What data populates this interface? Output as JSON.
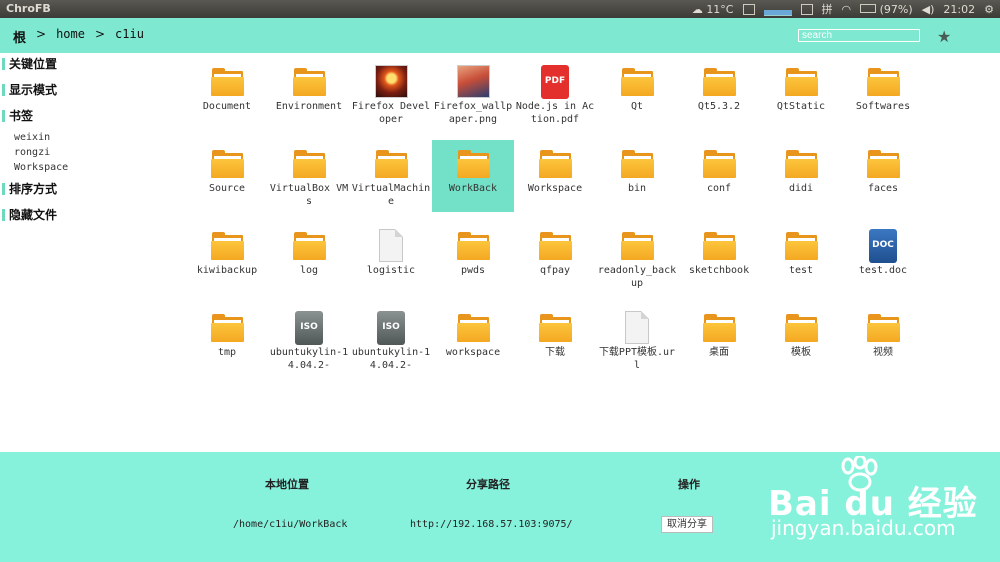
{
  "system_bar": {
    "app_title": "ChroFB",
    "temperature": "11°C",
    "battery": "(97%)",
    "clock": "21:02"
  },
  "header": {
    "breadcrumb": [
      "根",
      ">",
      "home",
      ">",
      "c1iu"
    ],
    "search_placeholder": "search"
  },
  "sidebar": {
    "key_locations": "关键位置",
    "display_mode": "显示模式",
    "bookmarks": "书签",
    "bookmark_items": [
      "weixin",
      "rongzi",
      "Workspace"
    ],
    "sort_mode": "排序方式",
    "hidden_files": "隐藏文件"
  },
  "files": [
    {
      "name": "Document",
      "type": "folder"
    },
    {
      "name": "Environment",
      "type": "folder"
    },
    {
      "name": "Firefox Developer",
      "type": "image"
    },
    {
      "name": "Firefox_wallpaper.png",
      "type": "image2"
    },
    {
      "name": "Node.js in Action.pdf",
      "type": "pdf"
    },
    {
      "name": "Qt",
      "type": "folder"
    },
    {
      "name": "Qt5.3.2",
      "type": "folder"
    },
    {
      "name": "QtStatic",
      "type": "folder"
    },
    {
      "name": "Softwares",
      "type": "folder"
    },
    {
      "name": "Source",
      "type": "folder"
    },
    {
      "name": "VirtualBox VMs",
      "type": "folder"
    },
    {
      "name": "VirtualMachine",
      "type": "folder"
    },
    {
      "name": "WorkBack",
      "type": "folder",
      "selected": true
    },
    {
      "name": "Workspace",
      "type": "folder"
    },
    {
      "name": "bin",
      "type": "folder"
    },
    {
      "name": "conf",
      "type": "folder"
    },
    {
      "name": "didi",
      "type": "folder"
    },
    {
      "name": "faces",
      "type": "folder"
    },
    {
      "name": "kiwibackup",
      "type": "folder"
    },
    {
      "name": "log",
      "type": "folder"
    },
    {
      "name": "logistic",
      "type": "blank"
    },
    {
      "name": "pwds",
      "type": "folder"
    },
    {
      "name": "qfpay",
      "type": "folder"
    },
    {
      "name": "readonly_backup",
      "type": "folder"
    },
    {
      "name": "sketchbook",
      "type": "folder"
    },
    {
      "name": "test",
      "type": "folder"
    },
    {
      "name": "test.doc",
      "type": "doc"
    },
    {
      "name": "tmp",
      "type": "folder"
    },
    {
      "name": "ubuntukylin-14.04.2-",
      "type": "iso"
    },
    {
      "name": "ubuntukylin-14.04.2-",
      "type": "iso"
    },
    {
      "name": "workspace",
      "type": "folder"
    },
    {
      "name": "下载",
      "type": "folder"
    },
    {
      "name": "下载PPT模板.url",
      "type": "blank"
    },
    {
      "name": "桌面",
      "type": "folder"
    },
    {
      "name": "模板",
      "type": "folder"
    },
    {
      "name": "视频",
      "type": "folder"
    }
  ],
  "share_panel": {
    "col_location": "本地位置",
    "col_share_path": "分享路径",
    "col_action": "操作",
    "location_value": "/home/c1iu/WorkBack",
    "share_path_value": "http://192.168.57.103:9075/",
    "cancel_label": "取消分享"
  },
  "watermark": {
    "logo": "Bai du 经验",
    "url": "jingyan.baidu.com"
  }
}
